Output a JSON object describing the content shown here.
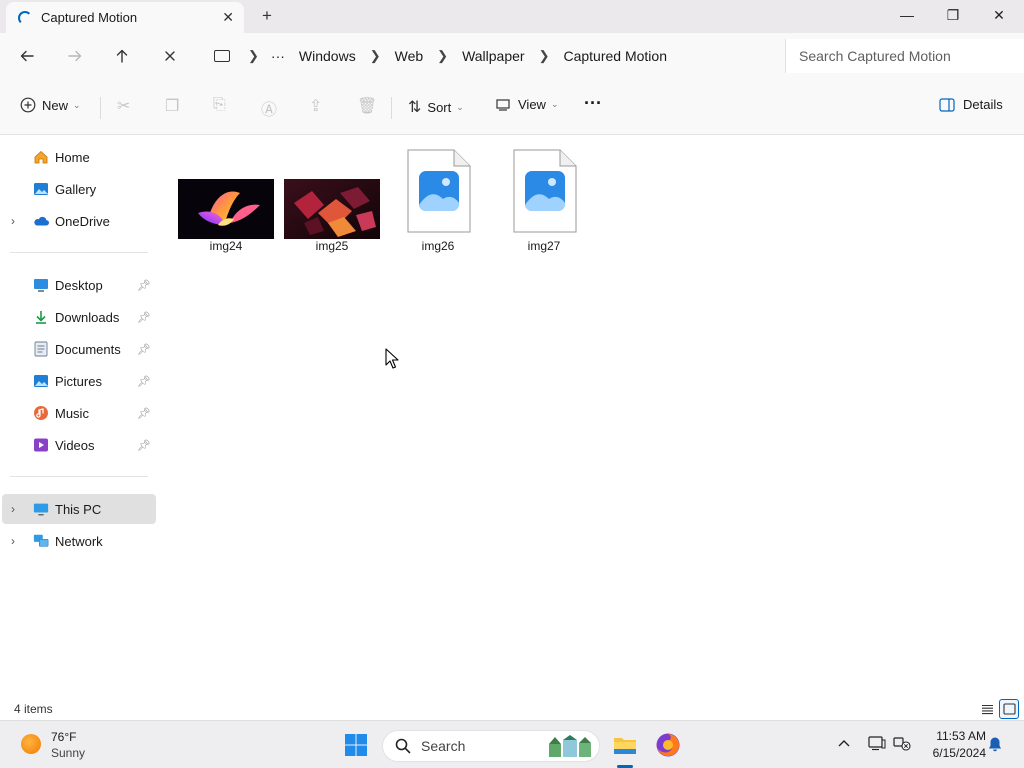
{
  "window": {
    "tab_title": "Captured Motion",
    "tab_close": "✕",
    "new_tab": "+",
    "minimize": "—",
    "maximize": "❐",
    "close": "✕"
  },
  "address": {
    "overflow": "···",
    "crumbs": [
      "Windows",
      "Web",
      "Wallpaper",
      "Captured Motion"
    ],
    "search_placeholder": "Search Captured Motion"
  },
  "toolbar": {
    "new_label": "New",
    "sort_label": "Sort",
    "view_label": "View",
    "more": "···",
    "details_label": "Details"
  },
  "sidebar": {
    "quick": [
      {
        "label": "Home",
        "icon": "home-icon"
      },
      {
        "label": "Gallery",
        "icon": "gallery-icon"
      },
      {
        "label": "OneDrive",
        "icon": "onedrive-icon"
      }
    ],
    "pinned": [
      {
        "label": "Desktop",
        "icon": "desktop-icon"
      },
      {
        "label": "Downloads",
        "icon": "downloads-icon"
      },
      {
        "label": "Documents",
        "icon": "documents-icon"
      },
      {
        "label": "Pictures",
        "icon": "pictures-icon"
      },
      {
        "label": "Music",
        "icon": "music-icon"
      },
      {
        "label": "Videos",
        "icon": "videos-icon"
      }
    ],
    "devices": [
      {
        "label": "This PC",
        "icon": "this-pc-icon",
        "selected": true
      },
      {
        "label": "Network",
        "icon": "network-icon"
      }
    ]
  },
  "files": [
    {
      "name": "img24",
      "kind": "thumbnail"
    },
    {
      "name": "img25",
      "kind": "thumbnail"
    },
    {
      "name": "img26",
      "kind": "image-file-icon"
    },
    {
      "name": "img27",
      "kind": "image-file-icon"
    }
  ],
  "status": {
    "item_count": "4 items"
  },
  "taskbar": {
    "weather_temp": "76°F",
    "weather_condition": "Sunny",
    "search_label": "Search",
    "time": "11:53 AM",
    "date": "6/15/2024"
  },
  "colors": {
    "accent": "#0067c0",
    "selected_bg": "#e0e0e0",
    "chrome_bg": "#f9f9f9"
  }
}
